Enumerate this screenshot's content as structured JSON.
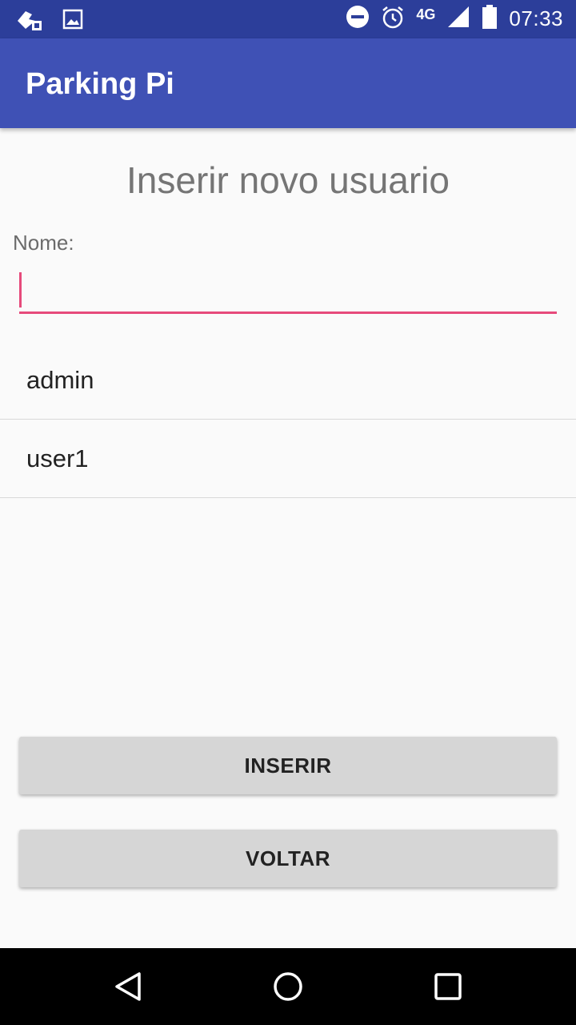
{
  "status_bar": {
    "time": "07:33",
    "network": "4G",
    "icons": [
      "notification-icon",
      "image-icon",
      "do-not-disturb-icon",
      "alarm-icon",
      "signal-icon",
      "battery-icon"
    ]
  },
  "app_bar": {
    "title": "Parking Pi"
  },
  "form": {
    "heading": "Inserir novo usuario",
    "name_label": "Nome:",
    "name_value": ""
  },
  "users": [
    "admin",
    "user1"
  ],
  "buttons": {
    "insert_label": "INSERIR",
    "back_label": "VOLTAR"
  },
  "colors": {
    "status_bar": "#2c3e9a",
    "app_bar": "#3f51b5",
    "accent": "#e64a7b"
  }
}
